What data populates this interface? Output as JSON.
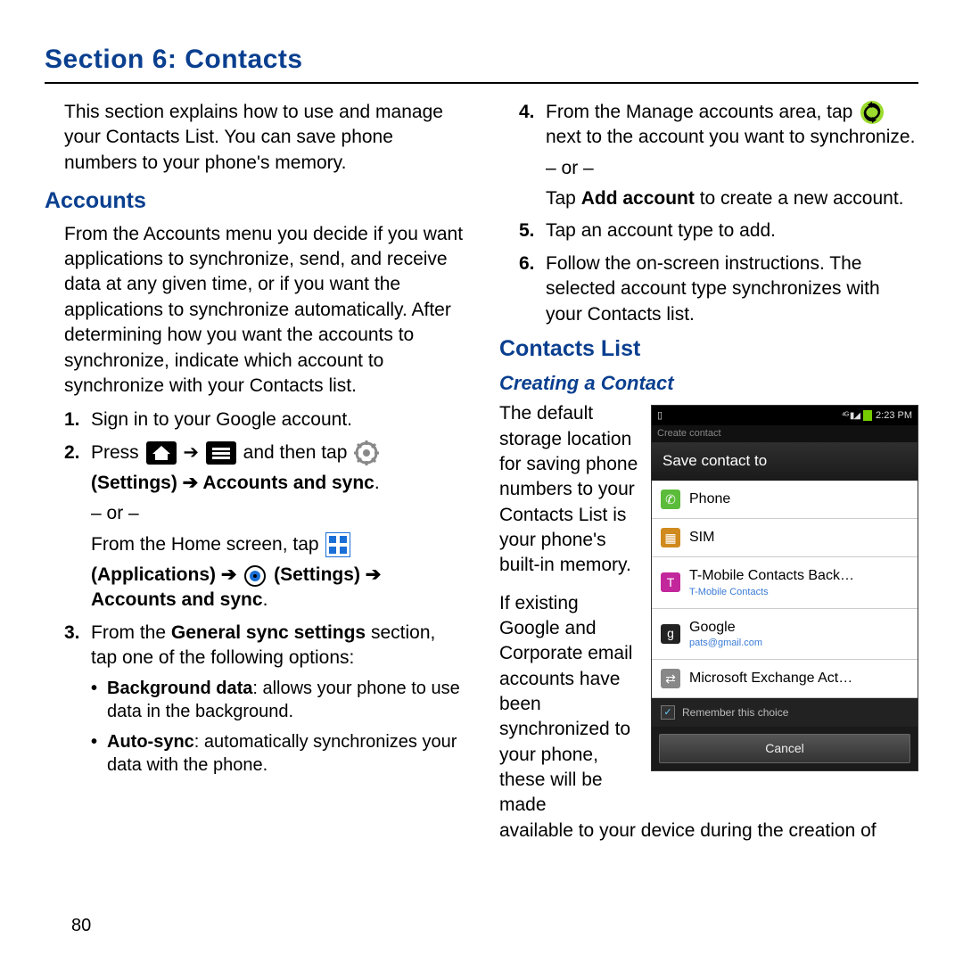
{
  "section_title": "Section 6: Contacts",
  "page_number": "80",
  "left": {
    "intro": "This section explains how to use and manage your Contacts List. You can save phone numbers to your phone's memory.",
    "h_accounts": "Accounts",
    "accounts_para": "From the Accounts menu you decide if you want applications to synchronize, send, and receive data at any given time, or if you want the applications to synchronize automatically. After determining how you want the accounts to synchronize, indicate which account to synchronize with your Contacts list.",
    "step1": "Sign in to your Google account.",
    "step2_a": "Press ",
    "step2_b": " and then tap ",
    "step2_c": "(Settings) ➔ Accounts and sync",
    "step2_d": ".",
    "step2_or": "– or –",
    "step2_e": "From the Home screen, tap ",
    "step2_f": "(Applications) ➔ ",
    "step2_g": " (Settings) ➔ Accounts and sync",
    "step2_h": ".",
    "step3_a": "From the ",
    "step3_b": "General sync settings",
    "step3_c": " section, tap one of the following options:",
    "bullet1_b": "Background data",
    "bullet1_t": ": allows your phone to use data in the background.",
    "bullet2_b": "Auto-sync",
    "bullet2_t": ": automatically synchronizes your data with the phone."
  },
  "right": {
    "step4_a": "From the Manage accounts area, tap ",
    "step4_b": " next to the account you want to synchronize.",
    "step4_or": "– or –",
    "step4_c": "Tap ",
    "step4_d": "Add account",
    "step4_e": " to create a new account.",
    "step5": "Tap an account type to add.",
    "step6": "Follow the on-screen instructions. The selected account type synchronizes with your Contacts list.",
    "h_contacts_list": "Contacts List",
    "h_creating": "Creating a Contact",
    "para1": "The default storage location for saving phone numbers to your Contacts List is your phone's built-in memory.",
    "para2": "If existing Google and Corporate email accounts have been synchronized to your phone, these will be made",
    "para3": "available to your device during the creation of"
  },
  "phone": {
    "time": "2:23 PM",
    "crumb": "Create contact",
    "dialog_title": "Save contact to",
    "opts": [
      {
        "label": "Phone",
        "sub": "",
        "color": "#5bbb3a",
        "glyph": "✆"
      },
      {
        "label": "SIM",
        "sub": "",
        "color": "#d08a1e",
        "glyph": "▦"
      },
      {
        "label": "T-Mobile Contacts Back…",
        "sub": "T-Mobile Contacts",
        "color": "#c3279c",
        "glyph": "T"
      },
      {
        "label": "Google",
        "sub": "pats@gmail.com",
        "color": "#222",
        "glyph": "g"
      },
      {
        "label": "Microsoft Exchange Act…",
        "sub": "",
        "color": "#888",
        "glyph": "⇄"
      }
    ],
    "remember": "Remember this choice",
    "cancel": "Cancel"
  }
}
